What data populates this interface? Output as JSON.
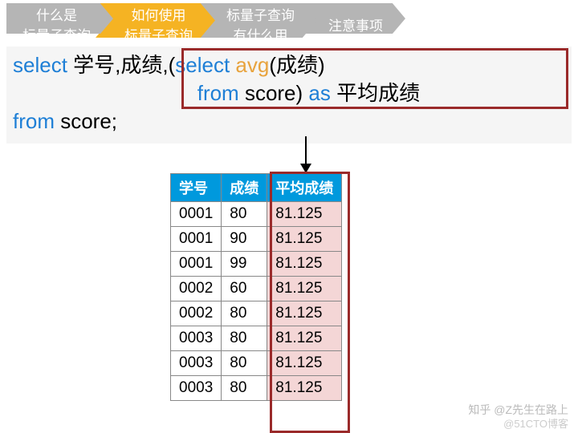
{
  "breadcrumb": {
    "items": [
      {
        "line1": "什么是",
        "line2": "标量子查询",
        "active": false
      },
      {
        "line1": "如何使用",
        "line2": "标量子查询",
        "active": true
      },
      {
        "line1": "标量子查询",
        "line2": "有什么用",
        "active": false
      },
      {
        "line1": "注意事项",
        "line2": "",
        "active": false
      }
    ]
  },
  "sql": {
    "select": "select",
    "cols": " 学号,成绩,(",
    "select2": "select",
    "avg": " avg",
    "avg_arg": "(成绩)",
    "from": "from",
    "score1": " score) ",
    "as": "as",
    "alias": " 平均成绩",
    "from2": "from",
    "score2": " score;"
  },
  "table": {
    "headers": [
      "学号",
      "成绩",
      "平均成绩"
    ],
    "rows": [
      [
        "0001",
        "80",
        "81.125"
      ],
      [
        "0001",
        "90",
        "81.125"
      ],
      [
        "0001",
        "99",
        "81.125"
      ],
      [
        "0002",
        "60",
        "81.125"
      ],
      [
        "0002",
        "80",
        "81.125"
      ],
      [
        "0003",
        "80",
        "81.125"
      ],
      [
        "0003",
        "80",
        "81.125"
      ],
      [
        "0003",
        "80",
        "81.125"
      ]
    ]
  },
  "watermark": {
    "w1": "知乎 @Z先生在路上",
    "w2": "@51CTO博客"
  }
}
